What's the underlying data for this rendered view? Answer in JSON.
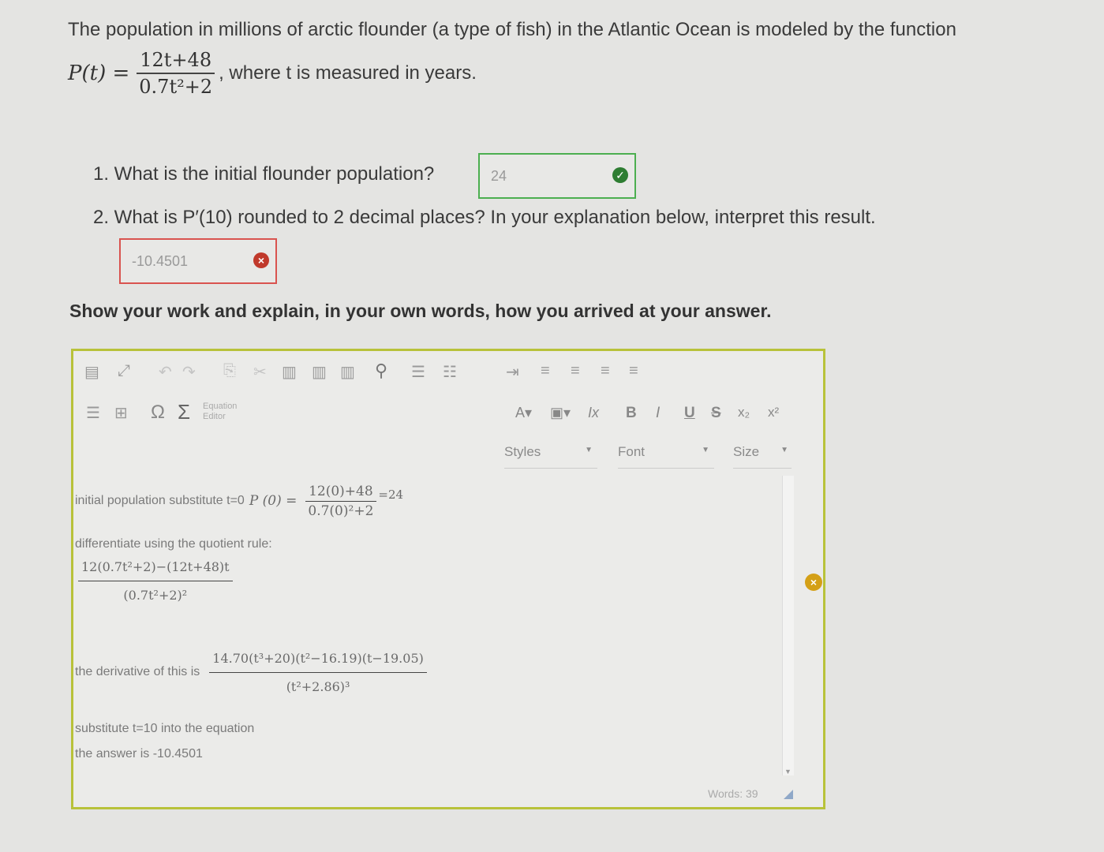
{
  "question": {
    "intro": "The population in millions of arctic flounder (a type of fish) in the Atlantic Ocean is modeled by the function",
    "func_lhs": "P(t) =",
    "func_num": "12t+48",
    "func_den": "0.7t²+2",
    "func_tail": ", where t is measured in years."
  },
  "q1": {
    "label": "1. What is the initial flounder population?",
    "answer": "24",
    "status": "correct"
  },
  "q2": {
    "label": "2. What is P′(10) rounded to 2 decimal places? In your explanation below, interpret this result.",
    "answer": "-10.4501",
    "status": "incorrect"
  },
  "instructions": "Show your work and explain, in your own words, how you arrived at your answer.",
  "toolbar": {
    "equation_editor_line1": "Equation",
    "equation_editor_line2": "Editor",
    "styles_label": "Styles",
    "font_label": "Font",
    "size_label": "Size",
    "bold": "B",
    "italic": "I",
    "underline": "U",
    "strike": "S",
    "subscript": "x₂",
    "superscript": "x²",
    "omega": "Ω",
    "sigma": "Σ"
  },
  "editor": {
    "line1_text": "initial population substitute t=0",
    "line1_lhs": "P (0) =",
    "line1_num": "12(0)+48",
    "line1_den": "0.7(0)²+2",
    "line1_result": "=24",
    "line2_text": "differentiate using the quotient rule:",
    "line3_num": "12(0.7t²+2)−(12t+48)t",
    "line3_den": "(0.7t²+2)²",
    "line4_text": "the derivative of this is",
    "line4_num": "14.70(t³+20)(t²−16.19)(t−19.05)",
    "line4_den": "(t²+2.86)³",
    "line5_text": "substitute t=10 into the equation",
    "line6_text": "the answer is -10.4501",
    "word_count": "Words: 39"
  },
  "colors": {
    "correct": "#2e7d32",
    "incorrect": "#c0392b",
    "editor_border": "#b8c23a",
    "accent_warning": "#d4a017"
  }
}
